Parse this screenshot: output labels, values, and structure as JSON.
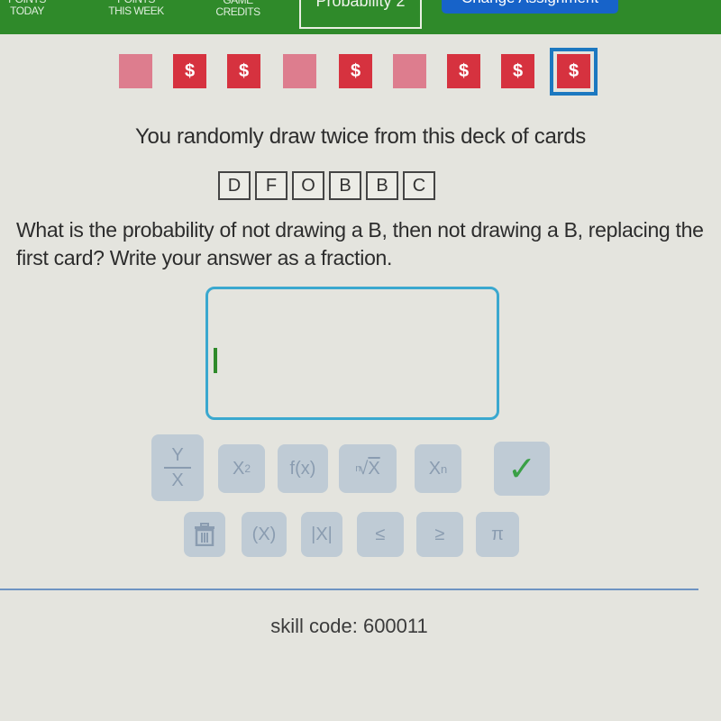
{
  "topbar": {
    "stats": [
      {
        "line1": "POINTS",
        "line2": "TODAY"
      },
      {
        "line1": "POINTS",
        "line2": "THIS WEEK"
      },
      {
        "line1": "GAME",
        "line2": "CREDITS"
      }
    ],
    "skill_tab": "Probability 2",
    "change_assignment": "Change Assignment",
    "accent_color": "#2f8a2a",
    "button_color": "#1763c9"
  },
  "progress": {
    "squares": [
      {
        "state": "empty",
        "symbol": ""
      },
      {
        "state": "earned",
        "symbol": "$"
      },
      {
        "state": "earned",
        "symbol": "$"
      },
      {
        "state": "empty",
        "symbol": ""
      },
      {
        "state": "earned",
        "symbol": "$"
      },
      {
        "state": "empty",
        "symbol": ""
      },
      {
        "state": "earned",
        "symbol": "$"
      },
      {
        "state": "earned",
        "symbol": "$"
      },
      {
        "state": "earned",
        "symbol": "$",
        "current": true
      }
    ],
    "earned_color": "#d6323f",
    "empty_color": "#dd7d8e"
  },
  "problem": {
    "prompt": "You randomly draw twice from this deck of cards",
    "deck": [
      "D",
      "F",
      "O",
      "B",
      "B",
      "C"
    ],
    "question": "What is the probability of not drawing a B, then not drawing a B, replacing the first card? Write your answer as a fraction."
  },
  "answer": {
    "value": "",
    "placeholder": ""
  },
  "keypad": {
    "fraction": {
      "num": "Y",
      "den": "X"
    },
    "square": {
      "base": "X",
      "exp": "2"
    },
    "function": "f(x)",
    "root": {
      "index": "n",
      "radicand": "X"
    },
    "subscript": {
      "base": "X",
      "sub": "n"
    },
    "submit": "✓",
    "paren": "(X)",
    "abs": "|X|",
    "le": "≤",
    "ge": "≥",
    "pi": "π"
  },
  "footer": {
    "skill_code": "skill code: 600011"
  }
}
